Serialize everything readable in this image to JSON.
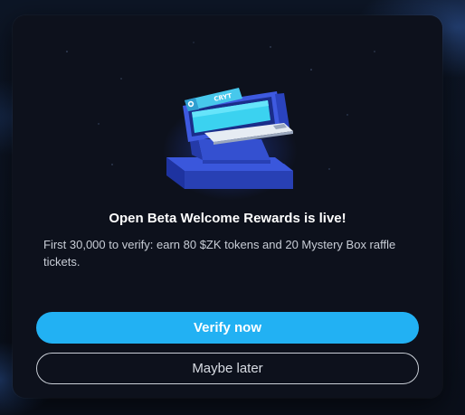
{
  "modal": {
    "illustration_icon": "verification-terminal-illustration",
    "card_brand_text": "CRYT",
    "title": "Open Beta Welcome Rewards is live!",
    "description": "First 30,000 to verify: earn 80 $ZK tokens and 20 Mystery Box raffle tickets.",
    "primary_button_label": "Verify now",
    "secondary_button_label": "Maybe later"
  },
  "colors": {
    "primary": "#22b1f3",
    "modal_bg": "#0d111c",
    "illustration_blue": "#3b56d6"
  }
}
